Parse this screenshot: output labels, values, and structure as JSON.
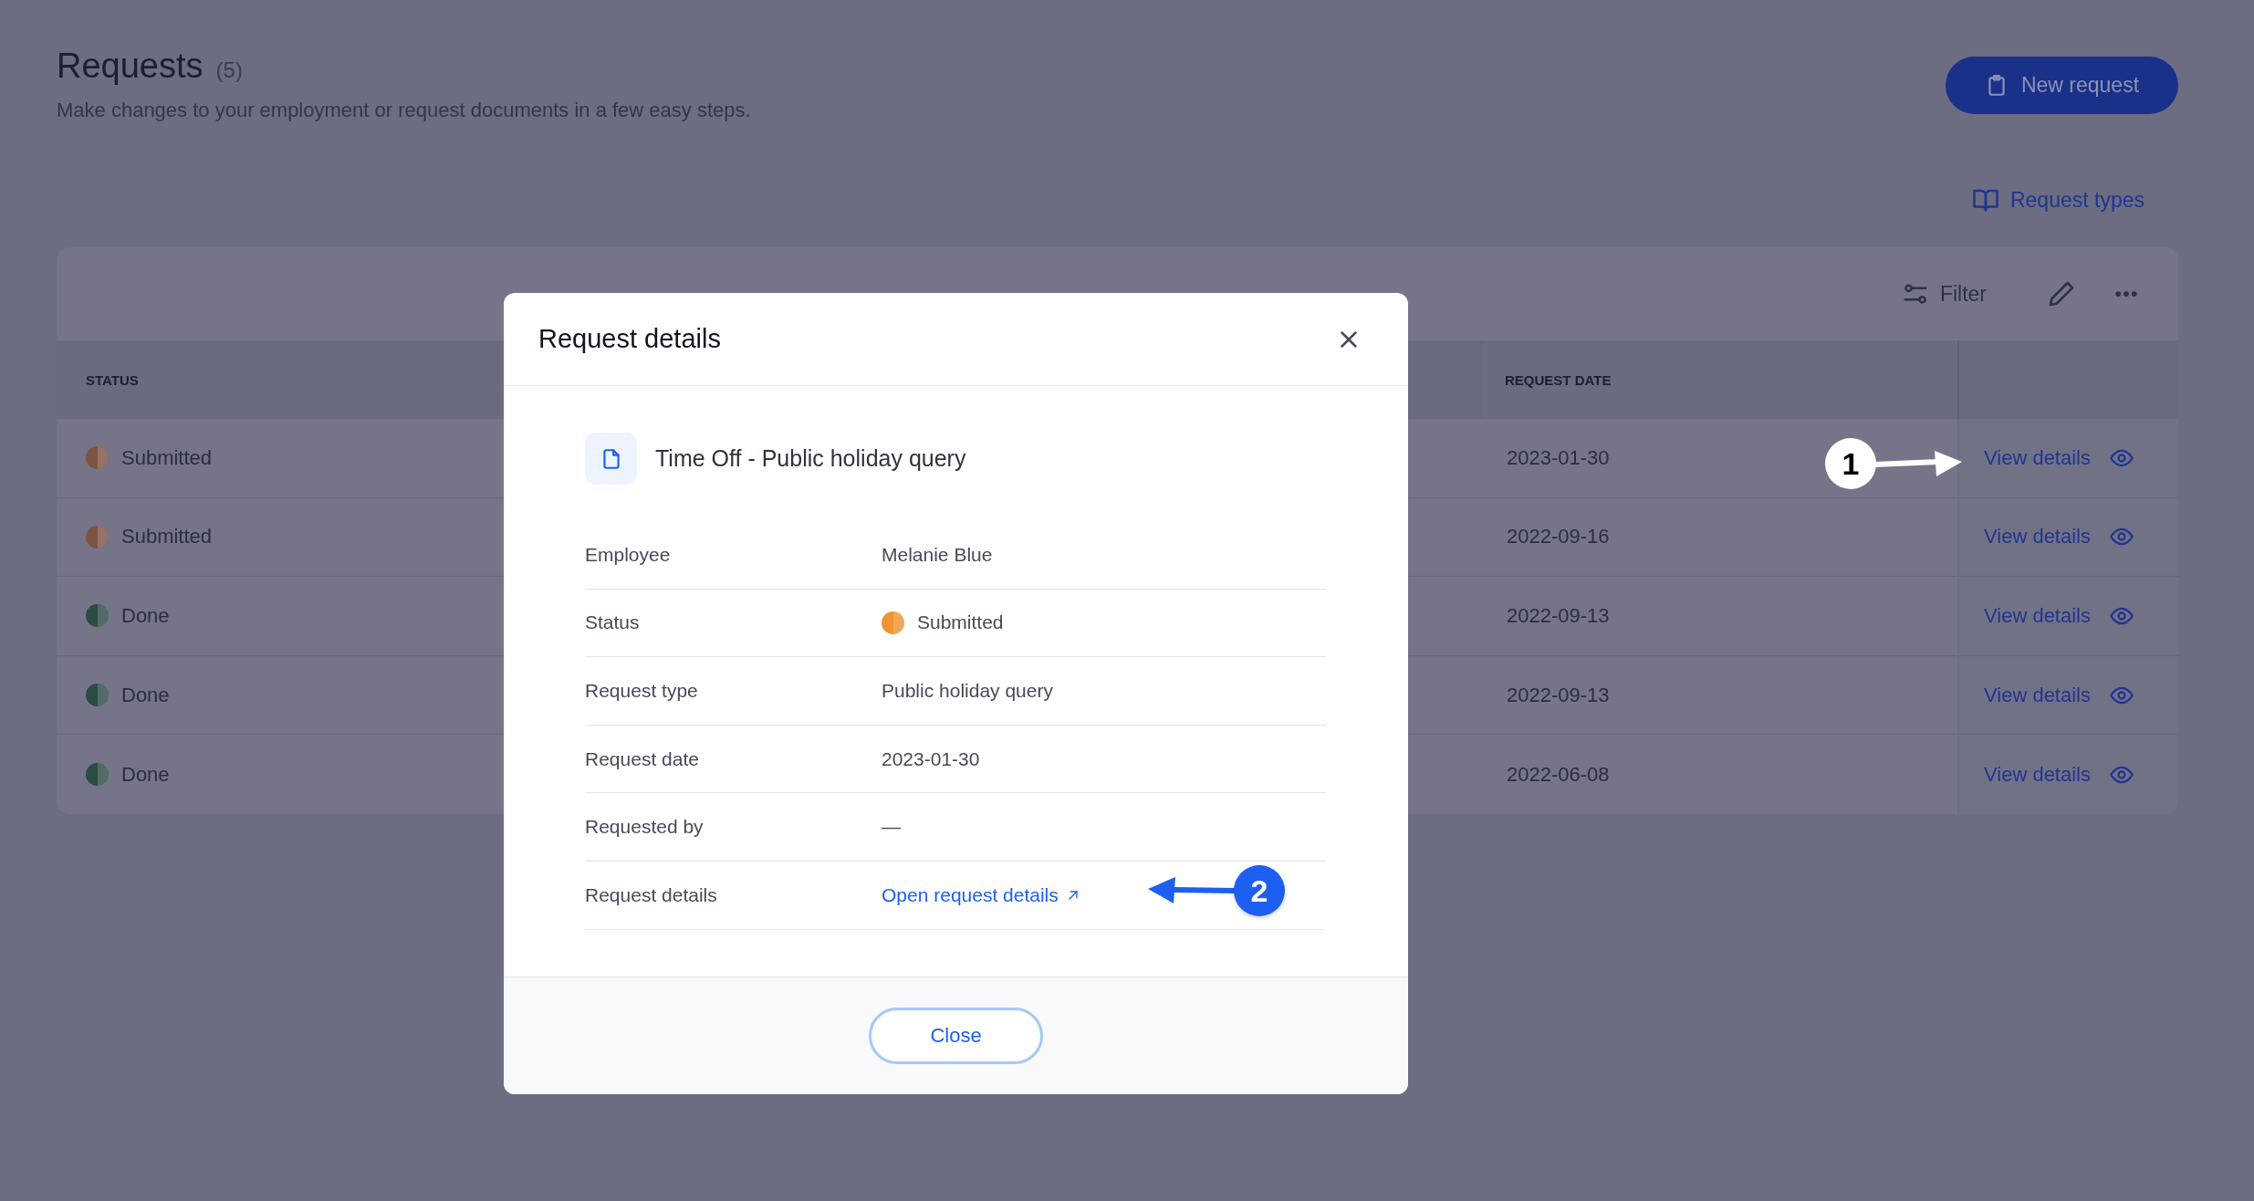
{
  "page": {
    "title": "Requests",
    "count": "(5)",
    "subtitle": "Make changes to your employment or request documents in a few easy steps."
  },
  "new_request_button": {
    "label": "New request"
  },
  "request_types_link": {
    "label": "Request types"
  },
  "toolbar": {
    "filter_label": "Filter"
  },
  "table": {
    "columns": [
      "STATUS",
      "REQUEST DATE"
    ],
    "rows": [
      {
        "status": "Submitted",
        "color": "#7d5443",
        "date": "2023-01-30",
        "action": "View details"
      },
      {
        "status": "Submitted",
        "color": "#7d5443",
        "date": "2022-09-16",
        "action": "View details"
      },
      {
        "status": "Done",
        "color": "#2b4c42",
        "date": "2022-09-13",
        "action": "View details"
      },
      {
        "status": "Done",
        "color": "#2b4c42",
        "date": "2022-09-13",
        "action": "View details"
      },
      {
        "status": "Done",
        "color": "#2b4c42",
        "date": "2022-06-08",
        "action": "View details"
      }
    ]
  },
  "modal": {
    "title": "Request details",
    "heading": "Time Off - Public holiday query",
    "fields": [
      {
        "kind": "text",
        "label": "Employee",
        "value": "Melanie Blue"
      },
      {
        "kind": "status",
        "label": "Status",
        "value": "Submitted",
        "color": "#ee9530"
      },
      {
        "kind": "text",
        "label": "Request type",
        "value": "Public holiday query"
      },
      {
        "kind": "text",
        "label": "Request date",
        "value": "2023-01-30"
      },
      {
        "kind": "text",
        "label": "Requested by",
        "value": "—"
      },
      {
        "kind": "link",
        "label": "Request details",
        "value": "Open request details"
      }
    ],
    "close_button": "Close"
  },
  "annotations": [
    {
      "label": "1",
      "kind": "light"
    },
    {
      "label": "2",
      "kind": "blue"
    }
  ]
}
